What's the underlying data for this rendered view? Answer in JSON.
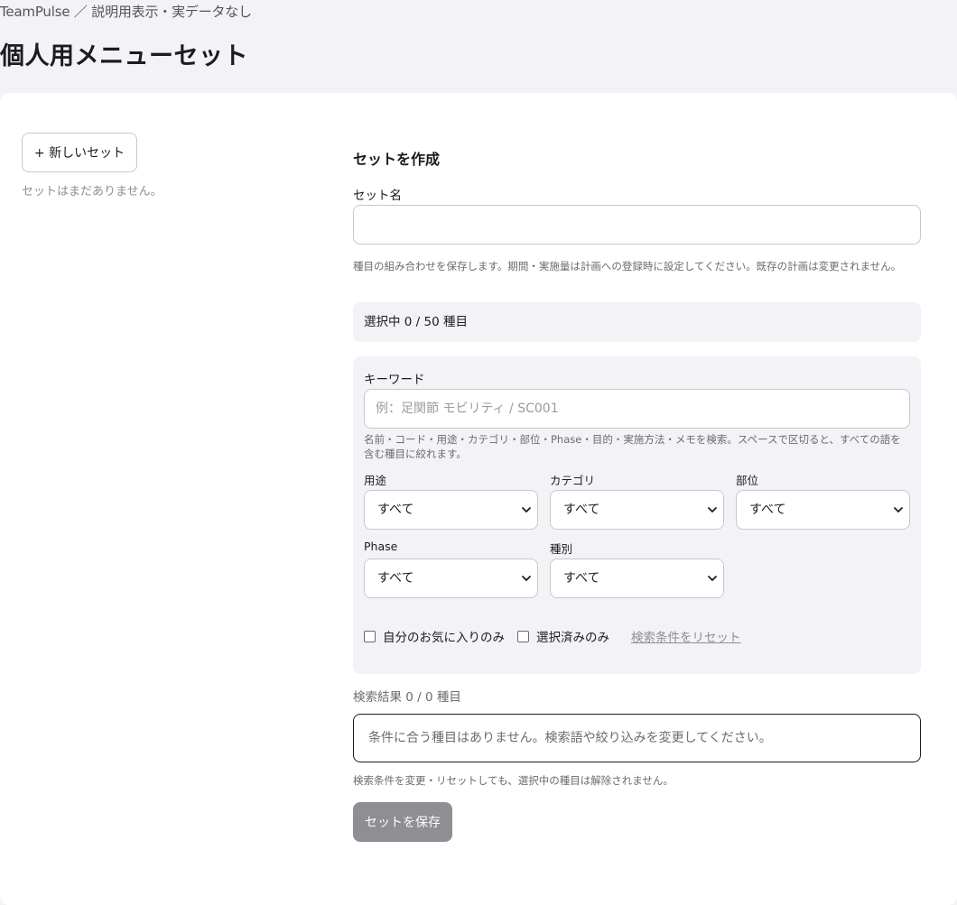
{
  "breadcrumb": "TeamPulse ／ 説明用表示・実データなし",
  "page_title": "個人用メニューセット",
  "sidebar": {
    "new_set_label": "+ 新しいセット",
    "empty_text": "セットはまだありません。"
  },
  "form": {
    "title": "セットを作成",
    "set_name_label": "セット名",
    "set_name_value": "",
    "set_name_hint": "種目の組み合わせを保存します。期間・実施量は計画への登録時に設定してください。既存の計画は変更されません。",
    "selected_count": "選択中 0 / 50 種目",
    "keyword_label": "キーワード",
    "keyword_placeholder": "例：足関節 モビリティ / SC001",
    "keyword_hint": "名前・コード・用途・カテゴリ・部位・Phase・目的・実施方法・メモを検索。スペースで区切ると、すべての語を含む種目に絞れます。",
    "filters": [
      {
        "label": "用途",
        "value": "すべて"
      },
      {
        "label": "カテゴリ",
        "value": "すべて"
      },
      {
        "label": "部位",
        "value": "すべて"
      },
      {
        "label": "Phase",
        "value": "すべて"
      },
      {
        "label": "種別",
        "value": "すべて"
      }
    ],
    "favorites_only_label": "自分のお気に入りのみ",
    "selected_only_label": "選択済みのみ",
    "reset_label": "検索条件をリセット",
    "results_count": "検索結果 0 / 0 種目",
    "empty_results": "条件に合う種目はありません。検索語や絞り込みを変更してください。",
    "reset_note": "検索条件を変更・リセットしても、選択中の種目は解除されません。",
    "save_label": "セットを保存"
  },
  "colors": {
    "page_bg": "#f2f2f7",
    "card_bg": "#ffffff",
    "save_button_disabled": "#8e8e93"
  }
}
